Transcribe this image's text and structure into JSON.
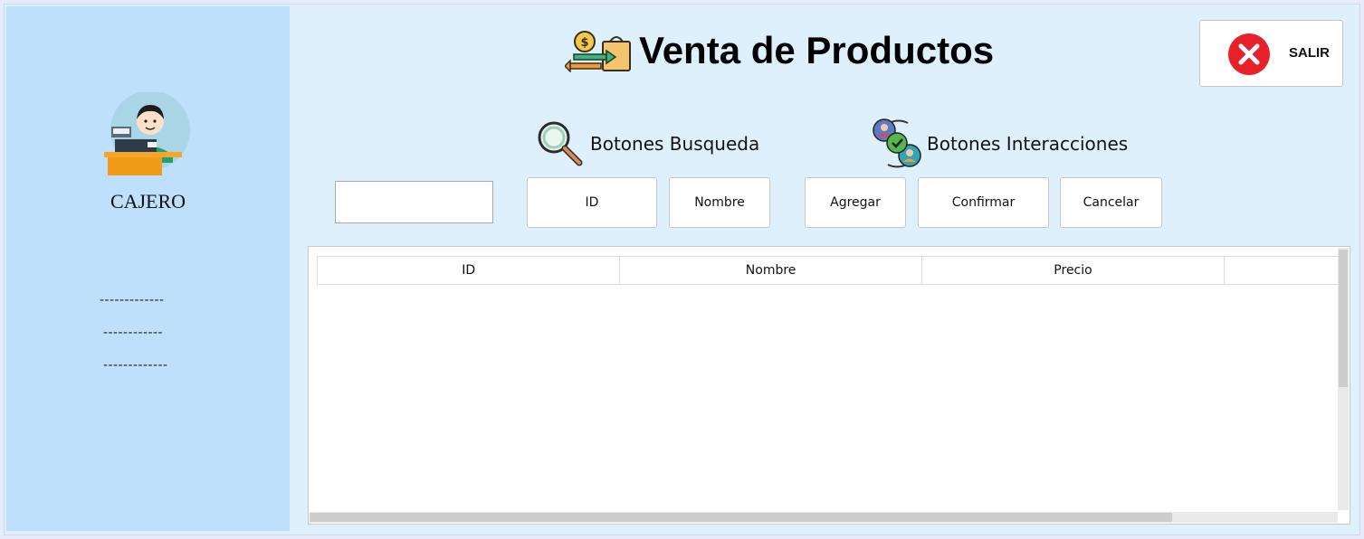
{
  "header": {
    "title": "Venta de Productos",
    "exit_label": "SALIR"
  },
  "sidebar": {
    "role": "CAJERO",
    "lines": [
      "-------------",
      "------------",
      "-------------"
    ]
  },
  "search": {
    "title": "Botones Busqueda",
    "input_value": "",
    "id_label": "ID",
    "name_label": "Nombre"
  },
  "actions": {
    "title": "Botones Interacciones",
    "add_label": "Agregar",
    "confirm_label": "Confirmar",
    "cancel_label": "Cancelar"
  },
  "table": {
    "columns": [
      "ID",
      "Nombre",
      "Precio",
      ""
    ],
    "rows": []
  },
  "icons": {
    "money": "money-transfer-icon",
    "search": "magnifier-icon",
    "users": "user-sync-icon",
    "exit": "close-circle-icon",
    "avatar": "cashier-avatar-icon"
  },
  "colors": {
    "sidebar": "#bfe0fc",
    "main_bg": "#dff0fd",
    "exit_red": "#e8212b"
  }
}
